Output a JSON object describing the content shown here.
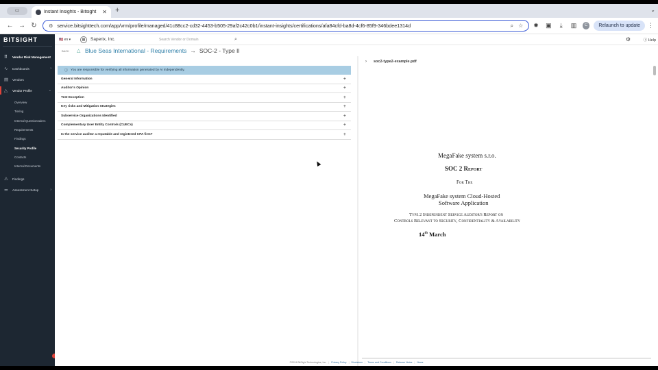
{
  "browser": {
    "tab_title": "Instant Insights - Bitsight",
    "url": "service.bitsighttech.com/app/vrm/profile/managed/41c88cc2-cd32-4453-b505-29af2c42c0b1/instant-insights/certifications/afa84cfd-ba8d-4cf6-85f9-346bdee1314d",
    "relaunch_label": "Relaunch to update",
    "avatar_letter": "C"
  },
  "sidebar": {
    "brand": "BITSIGHT",
    "section_title": "Vendor Risk Management",
    "items": [
      {
        "label": "Dashboards"
      },
      {
        "label": "Vendors"
      },
      {
        "label": "Vendor Profile"
      }
    ],
    "sub_items": [
      {
        "label": "Overview"
      },
      {
        "label": "Tiering"
      },
      {
        "label": "Internal Questionnaires"
      },
      {
        "label": "Requirements"
      },
      {
        "label": "Findings"
      },
      {
        "label": "Security Profile"
      },
      {
        "label": "Contacts"
      },
      {
        "label": "Internal Documents"
      }
    ],
    "bottom_items": [
      {
        "label": "Findings"
      },
      {
        "label": "Assessment Setup"
      }
    ]
  },
  "topbar": {
    "lang": "🇺🇸 en ▾",
    "org_name": "Saperix, Inc.",
    "search_placeholder": "Search Vendor or Domain",
    "help_label": "Help"
  },
  "breadcrumb": {
    "back_label": "BACK",
    "parent": "Blue Seas International - Requirements",
    "current": "SOC-2 - Type II"
  },
  "banner": "You are responsible for verifying all information generated by AI independently.",
  "sections": [
    {
      "label": "General Information"
    },
    {
      "label": "Auditor's Opinion"
    },
    {
      "label": "Test Exception"
    },
    {
      "label": "Key risks and Mitigation Strategies"
    },
    {
      "label": "Subservice Organizations Identified"
    },
    {
      "label": "Complementary User Entity Controls (CUECs)"
    },
    {
      "label": "Is the service auditor a reputable and registered CPA firm?"
    }
  ],
  "pdf": {
    "filename": "soc2-type2-example.pdf",
    "company": "MegaFake system s.r.o.",
    "title": "SOC 2 Report",
    "for": "For The",
    "system_line1": "MegaFake system Cloud-Hosted",
    "system_line2": "Software Application",
    "type_line1": "Type 2 Independent Service Auditor's Report on",
    "type_line2": "Controls Relevant to Security, Confidentiality & Availability",
    "date_day": "14",
    "date_suffix": "th",
    "date_month": " March"
  },
  "footer": {
    "copyright": "©2024 BitSight Technologies, Inc.",
    "links": [
      "Privacy Policy",
      "Disclaimer",
      "Terms and Conditions",
      "Release Notes",
      "News"
    ]
  }
}
